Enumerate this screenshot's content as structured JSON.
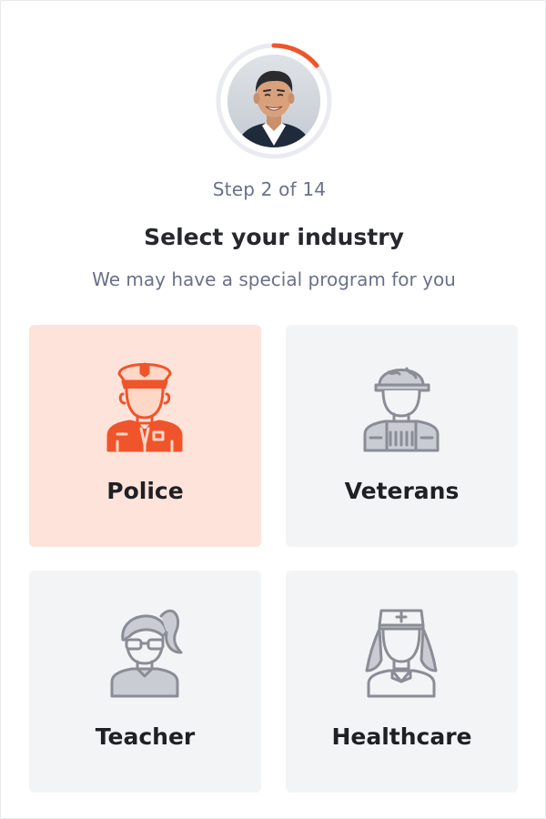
{
  "progress": {
    "step_text": "Step 2 of 14",
    "fraction": 0.14,
    "accent_color": "#f0542b",
    "track_color": "#e9ebf1"
  },
  "avatar": {
    "icon": "advisor-photo"
  },
  "header": {
    "title": "Select your industry",
    "subtitle": "We may have a special program for you"
  },
  "options": [
    {
      "label": "Police",
      "icon": "police-officer-icon",
      "selected": true
    },
    {
      "label": "Veterans",
      "icon": "soldier-icon",
      "selected": false
    },
    {
      "label": "Teacher",
      "icon": "teacher-icon",
      "selected": false
    },
    {
      "label": "Healthcare",
      "icon": "nurse-icon",
      "selected": false
    }
  ],
  "colors": {
    "selected_bg": "#fee3da",
    "card_bg": "#f3f4f6",
    "icon_selected": "#f0542b",
    "icon_default": "#8a8d96"
  }
}
